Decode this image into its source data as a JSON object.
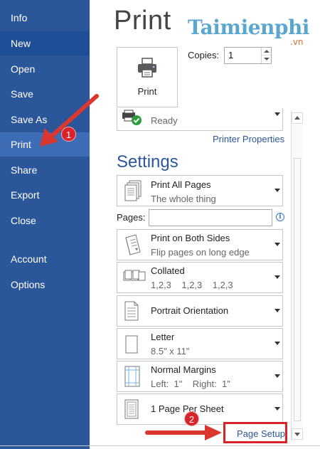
{
  "sidebar": {
    "items": [
      {
        "label": "Info"
      },
      {
        "label": "New"
      },
      {
        "label": "Open"
      },
      {
        "label": "Save"
      },
      {
        "label": "Save As"
      },
      {
        "label": "Print"
      },
      {
        "label": "Share"
      },
      {
        "label": "Export"
      },
      {
        "label": "Close"
      },
      {
        "label": "Account"
      },
      {
        "label": "Options"
      }
    ],
    "active": "Print",
    "color": "#2b579a"
  },
  "print": {
    "title": "Print",
    "button_label": "Print",
    "copies_label": "Copies:",
    "copies_value": "1",
    "printer_status": "Ready",
    "printer_properties": "Printer Properties"
  },
  "settings": {
    "title": "Settings",
    "print_pages": {
      "title": "Print All Pages",
      "subtitle": "The whole thing"
    },
    "pages_label": "Pages:",
    "pages_value": "",
    "sides": {
      "title": "Print on Both Sides",
      "subtitle": "Flip pages on long edge"
    },
    "collation": {
      "title": "Collated",
      "subtitle": "1,2,3    1,2,3    1,2,3"
    },
    "orientation": {
      "title": "Portrait Orientation"
    },
    "paper": {
      "title": "Letter",
      "subtitle": "8.5\" x 11\""
    },
    "margins": {
      "title": "Normal Margins",
      "subtitle": "Left:  1\"    Right:  1\""
    },
    "per_sheet": {
      "title": "1 Page Per Sheet"
    },
    "page_setup": "Page Setup"
  },
  "watermark": {
    "text": "Taimienphi",
    "suffix": ".vn"
  },
  "annotations": {
    "badge_1": "1",
    "badge_2": "2",
    "color": "#d9232a"
  }
}
